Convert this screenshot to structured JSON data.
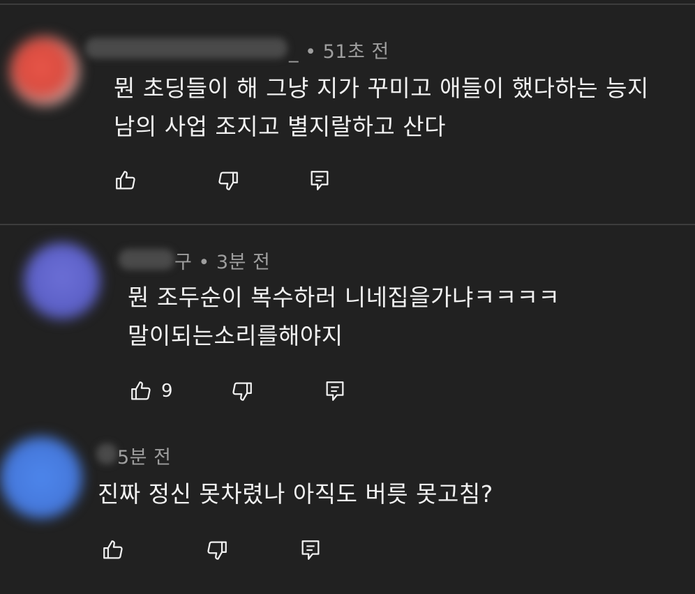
{
  "comments": [
    {
      "meta": "_ • 51초 전",
      "lines": [
        "뭔 초딩들이 해 그냥 지가 꾸미고 애들이 했다하는 능지",
        "남의 사업 조지고 별지랄하고 산다"
      ],
      "like_count": ""
    },
    {
      "meta": "구 • 3분 전",
      "lines": [
        "뭔 조두순이 복수하러 니네집을가냐ㅋㅋㅋㅋ",
        "말이되는소리를해야지"
      ],
      "like_count": "9"
    },
    {
      "meta": "5분 전",
      "lines": [
        "진짜 정신 못차렸나 아직도 버릇 못고침?"
      ],
      "like_count": ""
    }
  ],
  "colors": {
    "background": "#212121",
    "divider": "#3d3d3d",
    "text": "#f1f1f1",
    "meta_text": "#9e9e9e"
  },
  "icons": [
    "thumbs-up-icon",
    "thumbs-down-icon",
    "reply-icon"
  ]
}
